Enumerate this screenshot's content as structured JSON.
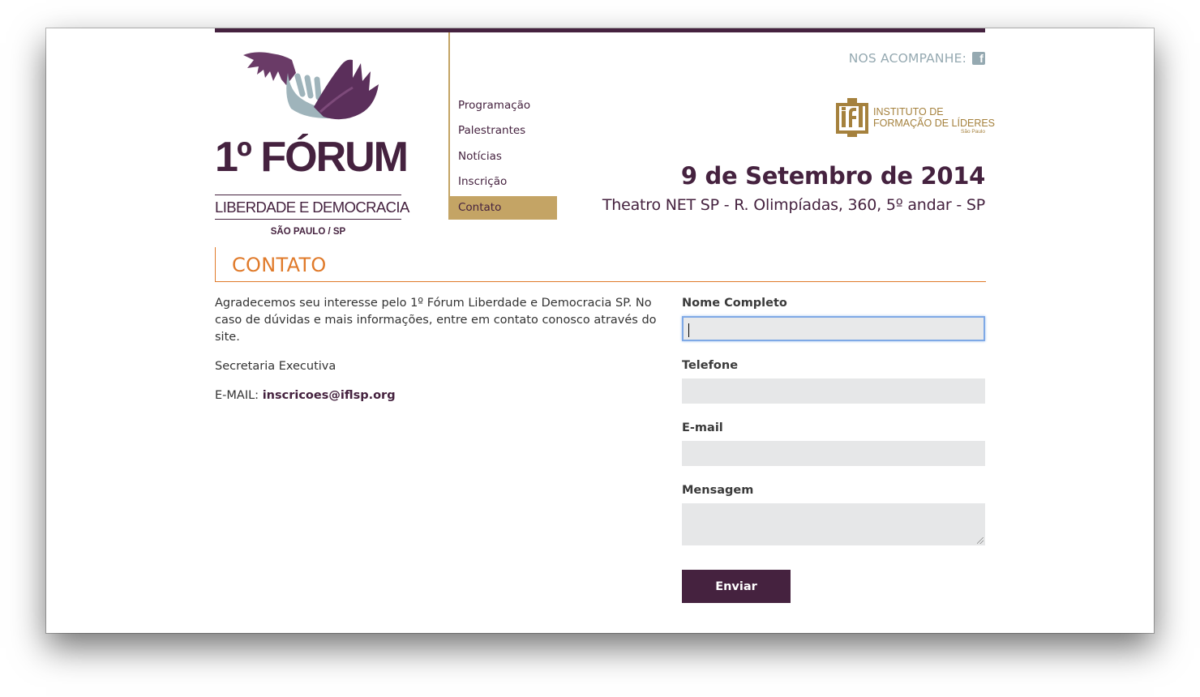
{
  "logo": {
    "title": "1º FÓRUM",
    "subtitle": "LIBERDADE E DEMOCRACIA",
    "city": "SÃO PAULO / SP"
  },
  "nav": {
    "items": [
      {
        "label": "Programação"
      },
      {
        "label": "Palestrantes"
      },
      {
        "label": "Notícias"
      },
      {
        "label": "Inscrição"
      },
      {
        "label": "Contato",
        "active": true
      }
    ]
  },
  "header": {
    "follow_label": "NOS ACOMPANHE:",
    "facebook_icon": "facebook-icon",
    "partner": {
      "line1": "INSTITUTO DE",
      "line2": "FORMAÇÃO DE LÍDERES",
      "small": "São Paulo"
    },
    "event_date": "9 de Setembro de 2014",
    "event_place": "Theatro NET SP - R. Olimpíadas, 360, 5º andar - SP"
  },
  "section": {
    "title": "CONTATO"
  },
  "content": {
    "intro": "Agradecemos seu interesse pelo 1º Fórum Liberdade e Democracia SP. No caso de dúvidas e mais informações, entre em contato conosco através do site.",
    "secretaria": "Secretaria Executiva",
    "email_label": "E-MAIL:",
    "email_value": "inscricoes@iflsp.org"
  },
  "form": {
    "name_label": "Nome Completo",
    "name_value": "",
    "phone_label": "Telefone",
    "phone_value": "",
    "email_label": "E-mail",
    "email_value": "",
    "message_label": "Mensagem",
    "message_value": "",
    "submit_label": "Enviar"
  },
  "colors": {
    "brand_purple": "#45223f",
    "gold": "#c4a465",
    "orange": "#e07a2a",
    "social_gray": "#95a9b1",
    "input_bg": "#e6e7e8"
  }
}
